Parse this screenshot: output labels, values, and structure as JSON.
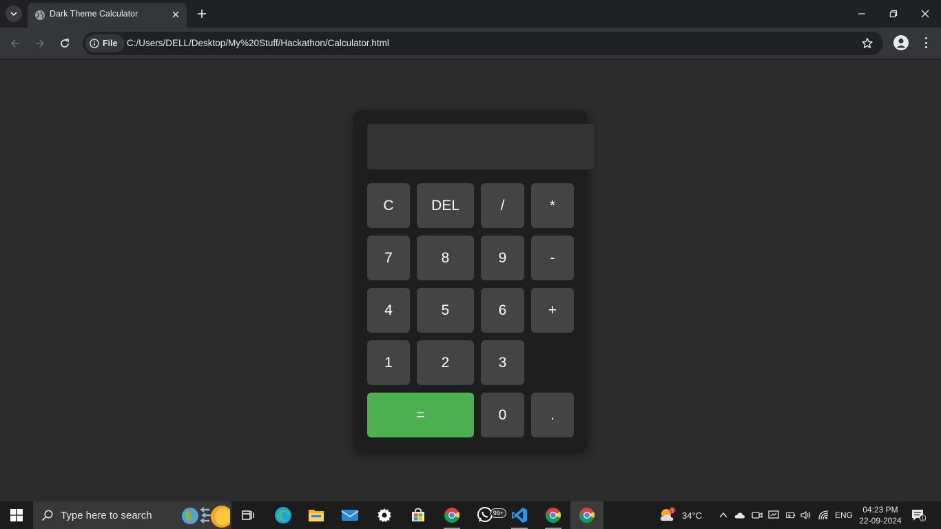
{
  "browser": {
    "tab_title": "Dark Theme Calculator",
    "file_chip_label": "File",
    "url": "C:/Users/DELL/Desktop/My%20Stuff/Hackathon/Calculator.html"
  },
  "calculator": {
    "display_value": "",
    "keys": {
      "clear": "C",
      "delete": "DEL",
      "divide": "/",
      "multiply": "*",
      "seven": "7",
      "eight": "8",
      "nine": "9",
      "minus": "-",
      "four": "4",
      "five": "5",
      "six": "6",
      "plus": "+",
      "one": "1",
      "two": "2",
      "three": "3",
      "equals": "=",
      "zero": "0",
      "decimal": "."
    },
    "colors": {
      "key": "#444444",
      "equals": "#4caf50",
      "panel": "#1e1e1e",
      "display": "#333333"
    }
  },
  "taskbar": {
    "search_placeholder": "Type here to search",
    "whatsapp_badge": "99+",
    "weather_temp": "34°C",
    "weather_alert": "1",
    "language": "ENG",
    "time": "04:23 PM",
    "date": "22-09-2024",
    "notification_count": "1"
  }
}
